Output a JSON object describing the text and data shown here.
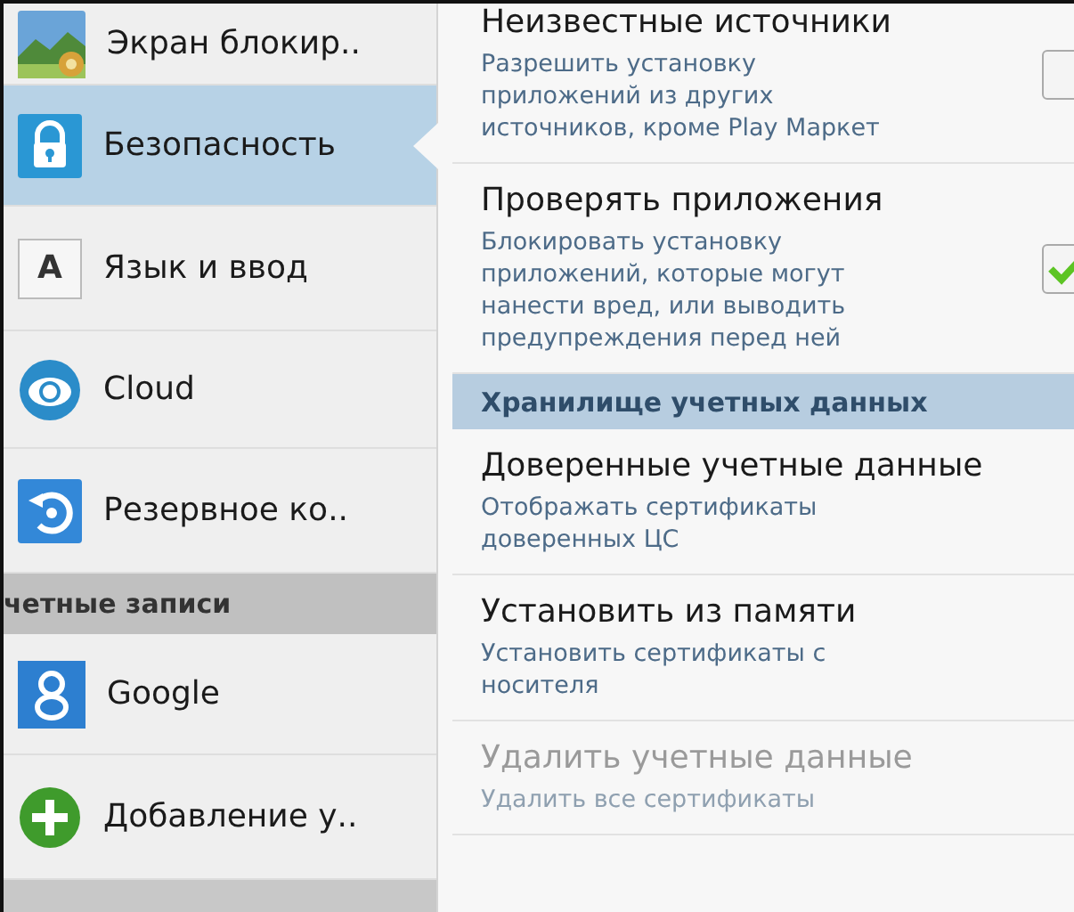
{
  "sidebar": {
    "items": [
      {
        "kind": "item",
        "label": "Экран блокир..",
        "selected": false
      },
      {
        "kind": "item",
        "label": "Безопасность",
        "selected": true
      },
      {
        "kind": "item",
        "glyph": "A",
        "label": "Язык и ввод",
        "selected": false
      },
      {
        "kind": "item",
        "label": "Cloud",
        "selected": false
      },
      {
        "kind": "item",
        "label": "Резервное ко..",
        "selected": false
      },
      {
        "kind": "header",
        "label": "четные записи"
      },
      {
        "kind": "item",
        "label": "Google",
        "selected": false
      },
      {
        "kind": "item",
        "label": "Добавление у..",
        "selected": false
      }
    ]
  },
  "settings": [
    {
      "kind": "checkbox",
      "title": "Неизвестные источники",
      "summary": "Разрешить установку приложений из других источников, кроме Play Маркет",
      "checked": false,
      "disabled": false
    },
    {
      "kind": "checkbox",
      "title": "Проверять приложения",
      "summary": "Блокировать установку приложений, которые могут нанести вред, или выводить предупреждения перед ней",
      "checked": true,
      "disabled": false
    },
    {
      "kind": "header",
      "title": "Хранилище учетных данных"
    },
    {
      "kind": "item",
      "title": "Доверенные учетные данные",
      "summary": "Отображать сертификаты доверенных ЦС",
      "disabled": false
    },
    {
      "kind": "item",
      "title": "Установить из памяти",
      "summary": "Установить сертификаты с носителя",
      "disabled": false
    },
    {
      "kind": "item",
      "title": "Удалить учетные данные",
      "summary": "Удалить все сертификаты",
      "disabled": true
    }
  ]
}
